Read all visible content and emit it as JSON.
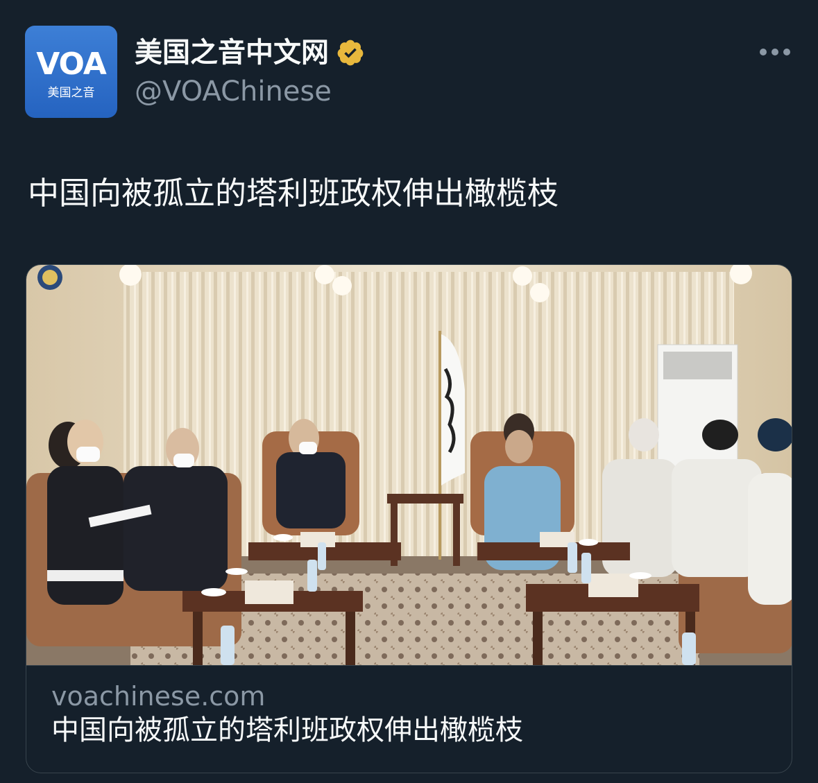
{
  "author": {
    "display_name": "美国之音中文网",
    "handle": "@VOAChinese",
    "avatar": {
      "logo_text": "VOA",
      "logo_subtext": "美国之音",
      "background": "#2f6fd0"
    },
    "verified_badge_color": "#e8b83d"
  },
  "tweet": {
    "text": "中国向被孤立的塔利班政权伸出橄榄枝"
  },
  "link_card": {
    "domain": "voachinese.com",
    "title": "中国向被孤立的塔利班政权伸出橄榄枝",
    "image_description_icon": "meeting-photo"
  },
  "colors": {
    "background": "#15202b",
    "primary_text": "#f7f9f9",
    "secondary_text": "#8b98a5",
    "border": "#38444d"
  }
}
